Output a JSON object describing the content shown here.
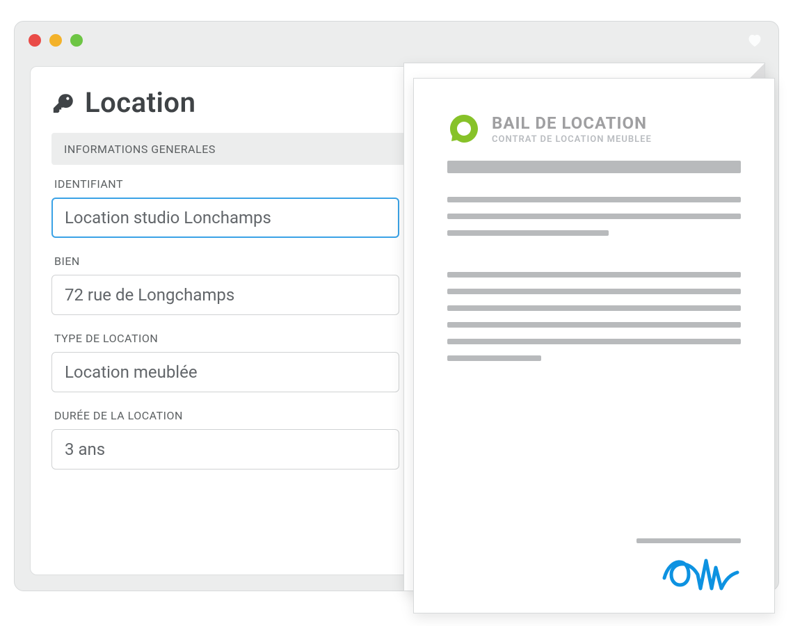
{
  "page": {
    "title": "Location"
  },
  "section": {
    "header": "INFORMATIONS GENERALES"
  },
  "fields": {
    "identifiant": {
      "label": "IDENTIFIANT",
      "value": "Location studio Lonchamps"
    },
    "bien": {
      "label": "BIEN",
      "value": "72 rue de Longchamps"
    },
    "type": {
      "label": "TYPE DE LOCATION",
      "value": "Location meublée"
    },
    "duree": {
      "label": "DURÉE DE LA LOCATION",
      "value": "3 ans"
    }
  },
  "document": {
    "title": "BAIL DE LOCATION",
    "subtitle": "CONTRAT DE LOCATION MEUBLEE"
  },
  "colors": {
    "accent_green": "#87c229",
    "focus_blue": "#3aa2e6",
    "signature_blue": "#0d92e1"
  }
}
